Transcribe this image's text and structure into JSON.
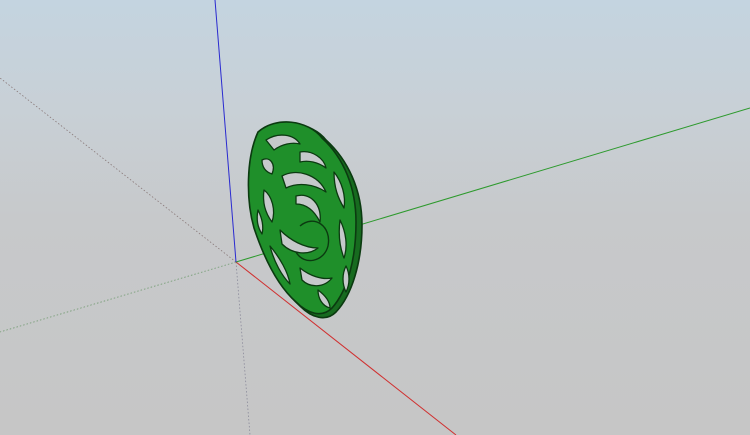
{
  "scene": {
    "sky_color": "#c4d4e0",
    "ground_color": "#c6c6c6",
    "axes": {
      "x_axis_color": "#d03030",
      "y_axis_color": "#2d9a2d",
      "z_axis_color": "#2a2ad0",
      "negative_axis_style": "dotted"
    },
    "model": {
      "name": "dragon-emblem",
      "fill_color": "#1f8f2a",
      "edge_color": "#0b3a10"
    }
  }
}
